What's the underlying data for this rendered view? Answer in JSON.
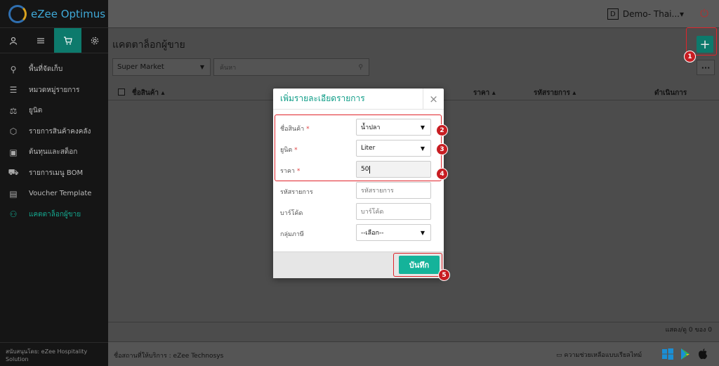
{
  "app": {
    "logo_text": "eZee Optimus"
  },
  "sidebar": {
    "items": [
      {
        "label": "พื้นที่จัดเก็บ",
        "icon": "location-pin-icon"
      },
      {
        "label": "หมวดหมู่รายการ",
        "icon": "list-icon"
      },
      {
        "label": "ยูนิต",
        "icon": "scale-icon"
      },
      {
        "label": "รายการสินค้าคงคลัง",
        "icon": "box-icon"
      },
      {
        "label": "ต้นทุนและสต็อก",
        "icon": "money-icon"
      },
      {
        "label": "รายการเมนู BOM",
        "icon": "cart-icon"
      },
      {
        "label": "Voucher Template",
        "icon": "voucher-icon"
      },
      {
        "label": "แคตตาล็อกผู้ขาย",
        "icon": "user-icon"
      }
    ],
    "footer": "สนับสนุนโดย: eZee Hospitality Solution"
  },
  "topbar": {
    "property_badge": "D",
    "property_name": "Demo- Thai...▾"
  },
  "content": {
    "page_title": "แคตตาล็อกผู้ขาย",
    "filter_value": "Super Market",
    "search_placeholder": "ค้นหา",
    "columns": {
      "product_name": "ชื่อสินค้า ▴",
      "price": "ราคา ▴",
      "item_code": "รหัสรายการ ▴",
      "action": "ดำเนินการ"
    },
    "pagination": "แสดง/ดู 0 ของ 0"
  },
  "bottombar": {
    "provider": "ชื่อสถานที่ให้บริการ : eZee Technosys",
    "help": "ความช่วยเหลือแบบเรียลไทม์"
  },
  "modal": {
    "title": "เพิ่มรายละเอียดรายการ",
    "fields": {
      "product_label": "ชื่อสินค้า",
      "product_value": "น้ำปลา",
      "unit_label": "ยูนิต",
      "unit_value": "Liter",
      "price_label": "ราคา",
      "price_value": "50",
      "code_label": "รหัสรายการ",
      "code_placeholder": "รหัสรายการ",
      "barcode_label": "บาร์โค้ด",
      "barcode_placeholder": "บาร์โค้ด",
      "tax_label": "กลุ่มภาษี",
      "tax_value": "--เลือก--"
    },
    "save_label": "บันทึก",
    "required_mark": "*"
  },
  "annotations": [
    "1",
    "2",
    "3",
    "4",
    "5"
  ],
  "colors": {
    "accent": "#14b39a",
    "annotation": "#e0242b"
  }
}
